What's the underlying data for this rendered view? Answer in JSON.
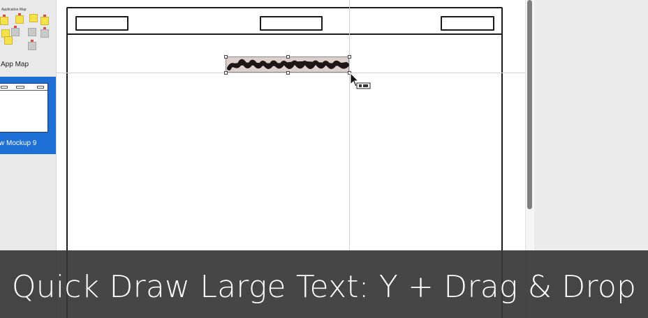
{
  "sidebar": {
    "app_map_thumb_title": "Application Map",
    "app_map_label": "App Map",
    "mockup_label": "w Mockup 9"
  },
  "caption": {
    "text": "Quick Draw Large Text: Y + Drag & Drop"
  },
  "colors": {
    "selection_blue": "#1d6fd6",
    "caption_bg": "#363636",
    "scribble_fill": "#ddd0cc"
  },
  "icons": {
    "cursor": "arrow-copy-cursor-icon"
  }
}
